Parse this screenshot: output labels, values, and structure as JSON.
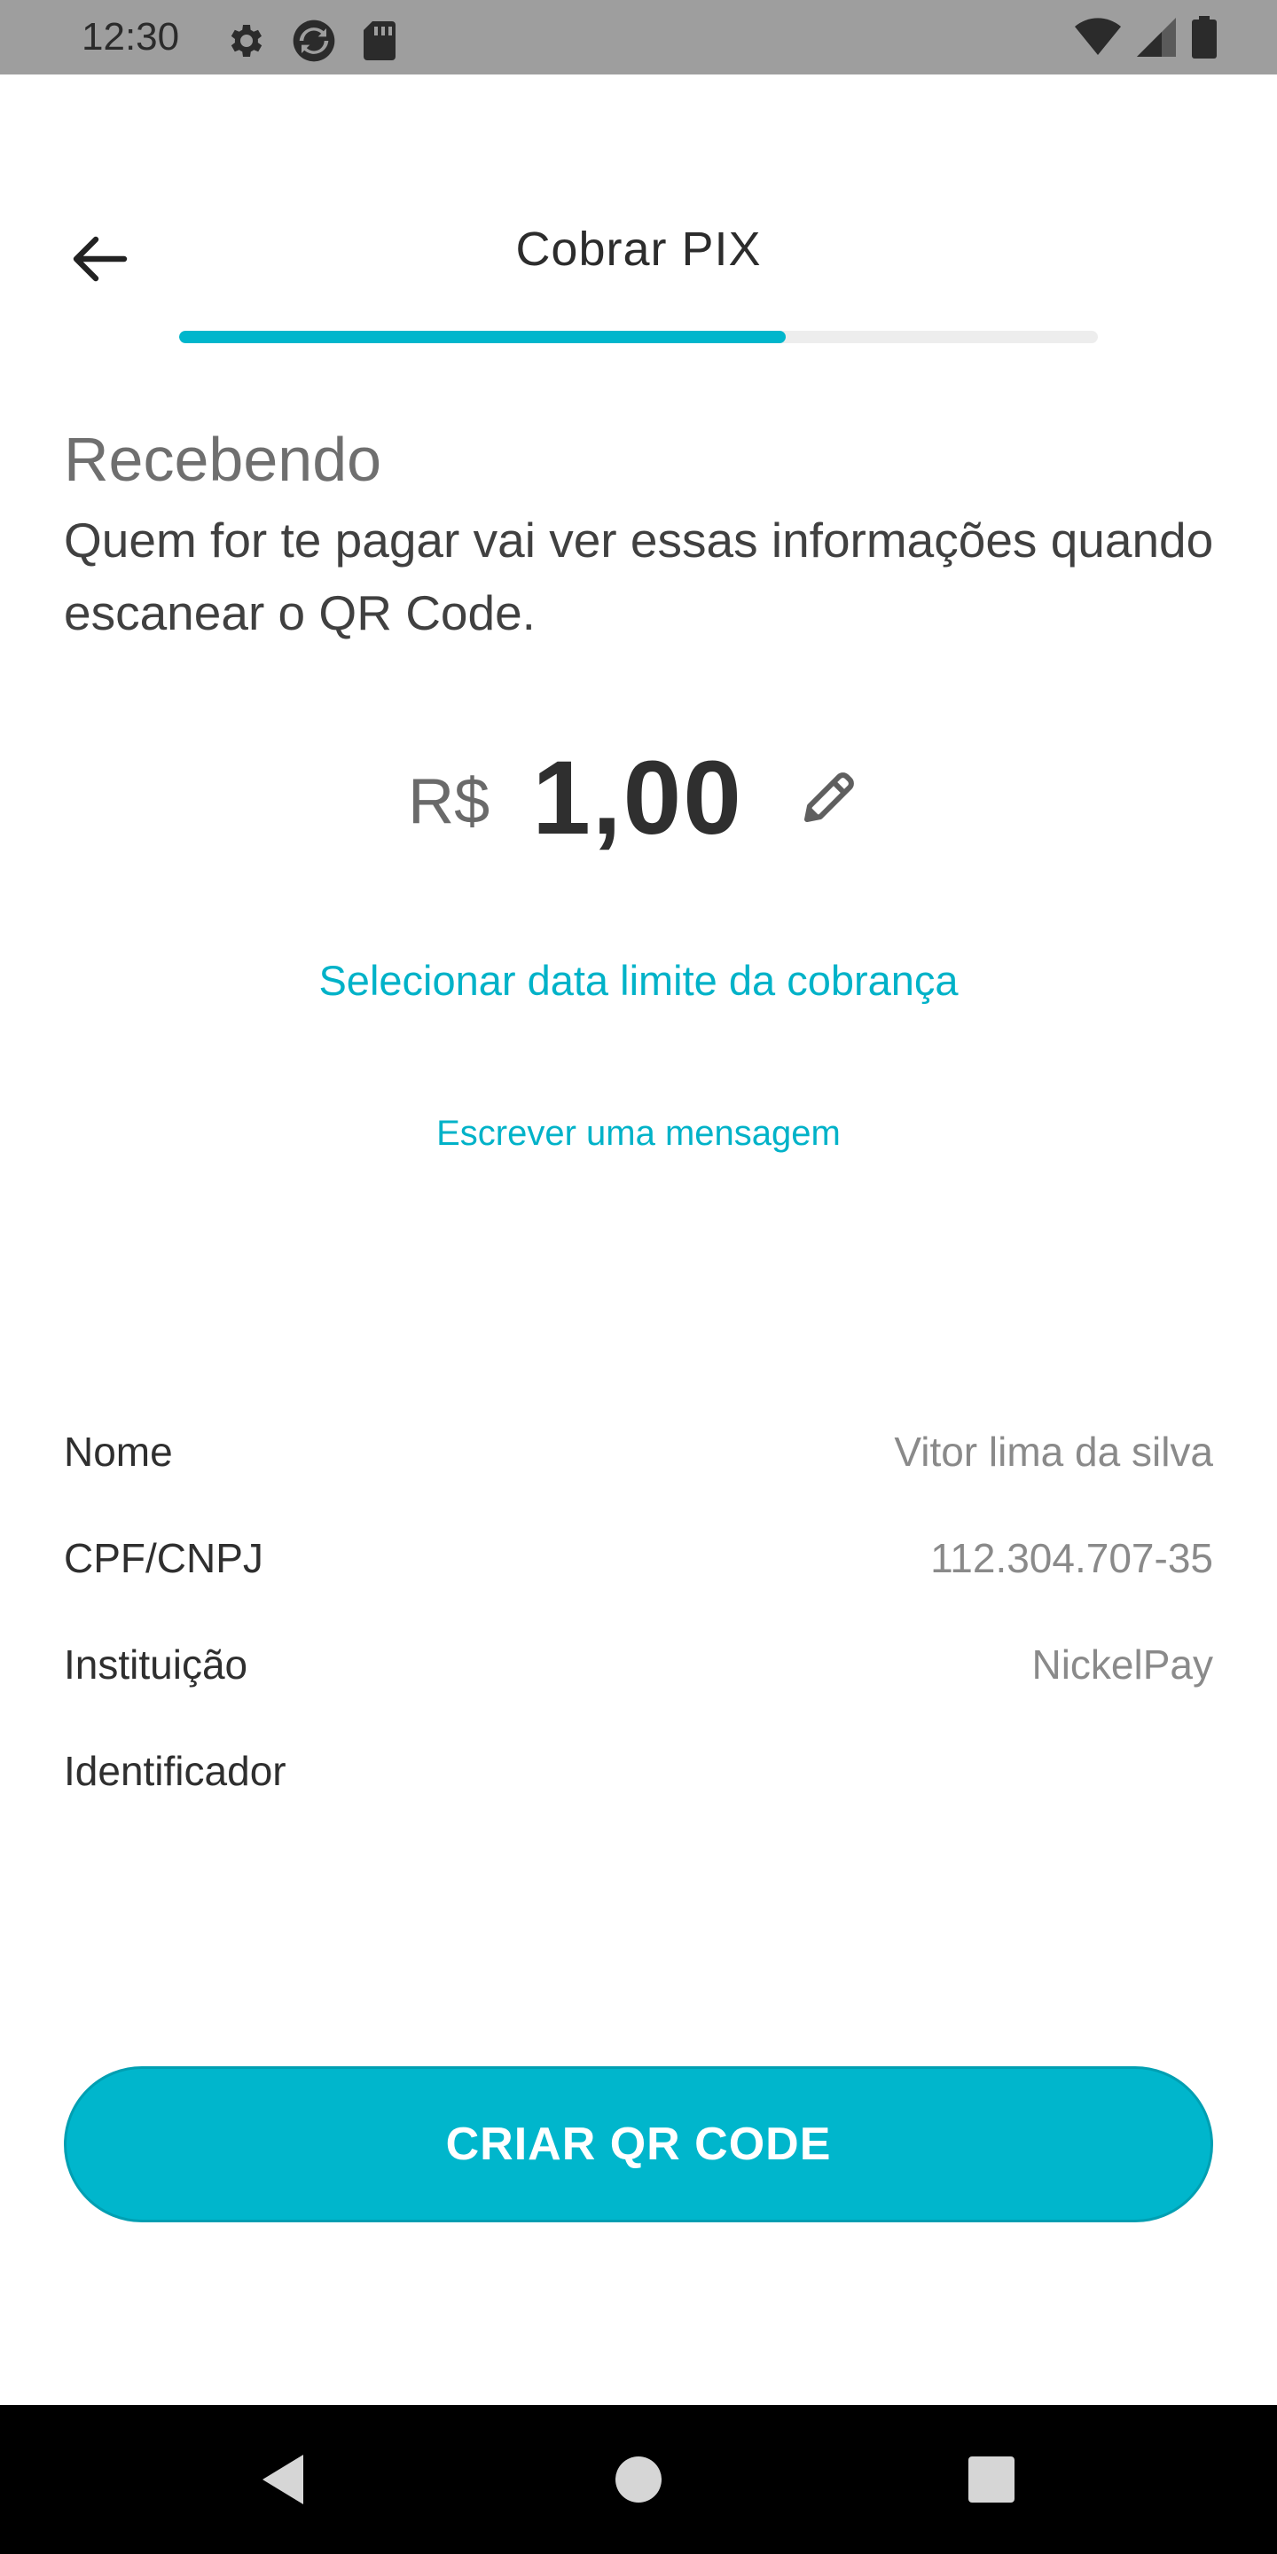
{
  "status_bar": {
    "time": "12:30",
    "icons_left": [
      "gear-icon",
      "sync-icon",
      "sd-card-icon"
    ],
    "icons_right": [
      "wifi-icon",
      "signal-icon",
      "battery-icon"
    ]
  },
  "app_bar": {
    "title": "Cobrar PIX",
    "back_icon": "arrow-left-icon"
  },
  "progress": {
    "fraction": 0.66,
    "color": "#00b6cc"
  },
  "content": {
    "title": "Recebendo",
    "description": "Quem for te pagar vai ver essas informações quando escanear o QR Code.",
    "currency": "R$",
    "amount": "1,00",
    "edit_icon": "pencil-icon",
    "date_link": "Selecionar data limite da cobrança",
    "message_link": "Escrever uma mensagem"
  },
  "info": {
    "rows": [
      {
        "label": "Nome",
        "value": "Vitor lima da silva"
      },
      {
        "label": "CPF/CNPJ",
        "value": "112.304.707-35"
      },
      {
        "label": "Instituição",
        "value": "NickelPay"
      },
      {
        "label": "Identificador",
        "value": ""
      }
    ]
  },
  "cta": {
    "label": "CRIAR QR CODE",
    "color": "#00b6cc"
  },
  "nav_bar": {
    "icons": [
      "back-triangle-icon",
      "home-circle-icon",
      "recents-square-icon"
    ]
  },
  "colors": {
    "accent": "#00b6cc",
    "link": "#00b2c8",
    "status_bar": "#9e9e9e"
  }
}
